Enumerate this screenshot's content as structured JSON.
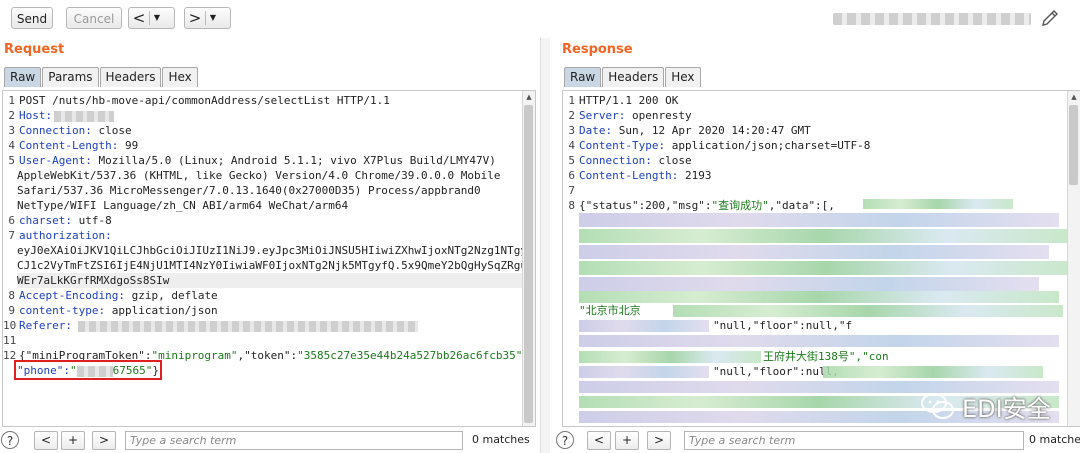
{
  "toolbar": {
    "send_label": "Send",
    "cancel_label": "Cancel",
    "back_arrow": "<",
    "forward_arrow": ">",
    "dropdown_glyph": "▼"
  },
  "request": {
    "title": "Request",
    "tabs": [
      "Raw",
      "Params",
      "Headers",
      "Hex"
    ],
    "lines": {
      "l1": {
        "num": "1",
        "text": "POST /nuts/hb-move-api/commonAddress/selectList HTTP/1.1"
      },
      "l2": {
        "num": "2",
        "key": "Host:"
      },
      "l3": {
        "num": "3",
        "key": "Connection:",
        "val": " close"
      },
      "l4": {
        "num": "4",
        "key": "Content-Length:",
        "val": " 99"
      },
      "l5": {
        "num": "5",
        "key": "User-Agent:",
        "val": " Mozilla/5.0 (Linux; Android 5.1.1; vivo X7Plus Build/LMY47V)"
      },
      "l5b": "AppleWebKit/537.36 (KHTML, like Gecko) Version/4.0 Chrome/39.0.0.0 Mobile",
      "l5c": "Safari/537.36 MicroMessenger/7.0.13.1640(0x27000D35) Process/appbrand0",
      "l5d": "NetType/WIFI Language/zh_CN ABI/arm64 WeChat/arm64",
      "l6": {
        "num": "6",
        "key": "charset:",
        "val": " utf-8"
      },
      "l7": {
        "num": "7",
        "key": "authorization:"
      },
      "l7b": "eyJ0eXAiOiJKV1QiLCJhbGciOiJIUzI1NiJ9.eyJpc3MiOiJNSU5HIiwiZXhwIjoxNTg2Nzg1NTgyL",
      "l7c": "CJ1c2VyTmFtZSI6IjE4NjU1MTI4NzY0IiwiaWF0IjoxNTg2Njk5MTgyfQ.5x9QmeY2bQgHySqZRgui",
      "l7d": "WEr7aLkKGrfRMXdgoSs8SIw",
      "l8": {
        "num": "8",
        "key": "Accept-Encoding:",
        "val": " gzip, deflate"
      },
      "l9": {
        "num": "9",
        "key": "content-type:",
        "val": " application/json"
      },
      "l10": {
        "num": "10",
        "key": "Referer:"
      },
      "l11": {
        "num": "11"
      },
      "l12": {
        "num": "12",
        "p1": "{\"miniProgramToken\":",
        "p2": "\"miniprogram\"",
        "p3": ",\"token\":",
        "p4": "\"3585c27e35e44b24a527bb26ac6fcb35\"",
        "p5": ","
      },
      "l12b": {
        "key": "\"phone\":",
        "val_tail": "67565\"",
        "close": "}"
      }
    },
    "search_placeholder": "Type a search term",
    "matches": "0 matches"
  },
  "response": {
    "title": "Response",
    "tabs": [
      "Raw",
      "Headers",
      "Hex"
    ],
    "lines": {
      "l1": {
        "num": "1",
        "text": "HTTP/1.1 200 OK"
      },
      "l2": {
        "num": "2",
        "key": "Server:",
        "val": " openresty"
      },
      "l3": {
        "num": "3",
        "key": "Date:",
        "val": " Sun, 12 Apr 2020 14:20:47 GMT"
      },
      "l4": {
        "num": "4",
        "key": "Content-Type:",
        "val": " application/json;charset=UTF-8"
      },
      "l5": {
        "num": "5",
        "key": "Connection:",
        "val": " close"
      },
      "l6": {
        "num": "6",
        "key": "Content-Length:",
        "val": " 2193"
      },
      "l7": {
        "num": "7"
      },
      "l8": {
        "num": "8",
        "p1": "{\"status\":200,\"msg\":",
        "p2": "\"查询成功\"",
        "p3": ",\"data\":[,"
      },
      "f1": "\"北京市北京",
      "f2": "\"null,\"floor\":null,\"f",
      "f3": "王府井大街138号\",\"con",
      "f4": "\"null,\"floor\":null,"
    },
    "search_placeholder": "Type a search term",
    "matches": "0 matches"
  },
  "help_glyph": "?",
  "prev_glyph": "<",
  "add_glyph": "+",
  "next_glyph": ">",
  "watermark": "EDI安全"
}
